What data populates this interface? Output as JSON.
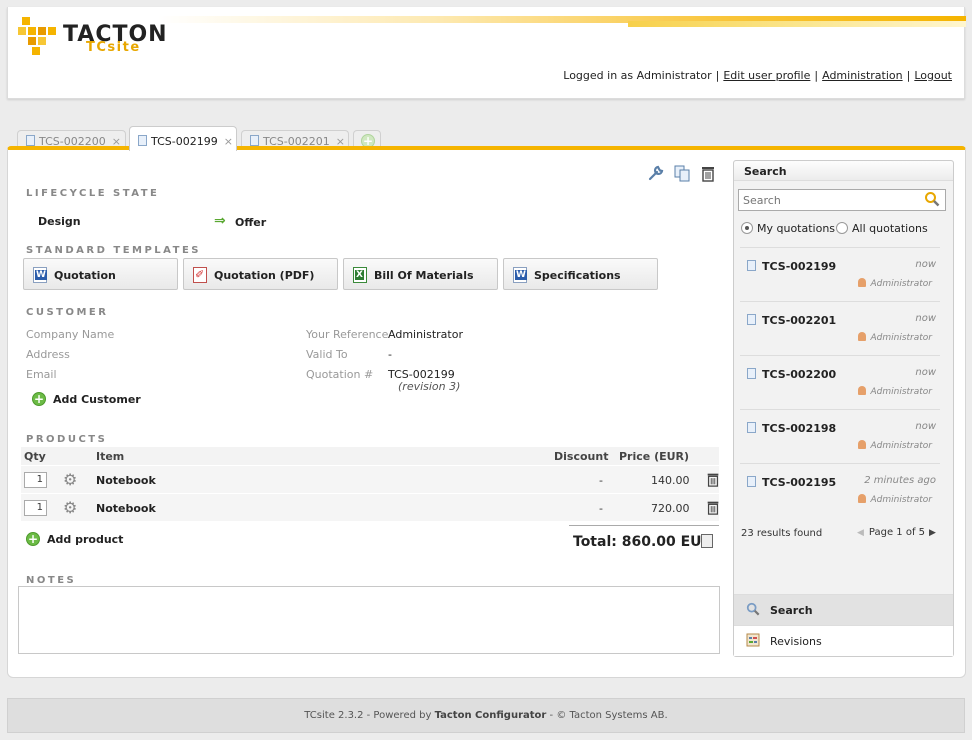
{
  "brand": {
    "name": "TACTON",
    "product": "TCsite"
  },
  "header": {
    "logged_in_text": "Logged in as Administrator",
    "edit_profile": "Edit user profile",
    "administration": "Administration",
    "logout": "Logout"
  },
  "tabs": [
    {
      "label": "TCS-002200",
      "active": false
    },
    {
      "label": "TCS-002199",
      "active": true
    },
    {
      "label": "TCS-002201",
      "active": false
    }
  ],
  "tab_close_glyph": "×",
  "tab_add_glyph": "+",
  "lifecycle": {
    "title": "LIFECYCLE STATE",
    "current": "Design",
    "next": "Offer",
    "arrow_glyph": "⇒"
  },
  "templates": {
    "title": "STANDARD TEMPLATES",
    "items": [
      "Quotation",
      "Quotation (PDF)",
      "Bill Of Materials",
      "Specifications"
    ]
  },
  "customer": {
    "title": "CUSTOMER",
    "company_label": "Company Name",
    "address_label": "Address",
    "email_label": "Email",
    "reference_label": "Your Reference",
    "reference_value": "Administrator",
    "valid_label": "Valid To",
    "valid_value": "-",
    "quotation_label": "Quotation #",
    "quotation_value": "TCS-002199",
    "revision": "(revision 3)",
    "add_customer": "Add Customer"
  },
  "products": {
    "title": "PRODUCTS",
    "headers": {
      "qty": "Qty",
      "item": "Item",
      "discount": "Discount",
      "price": "Price (EUR)"
    },
    "rows": [
      {
        "qty": "1",
        "item": "Notebook",
        "discount": "-",
        "price": "140.00"
      },
      {
        "qty": "1",
        "item": "Notebook",
        "discount": "-",
        "price": "720.00"
      }
    ],
    "add_product": "Add product",
    "total": "Total: 860.00 EUR"
  },
  "notes": {
    "title": "NOTES"
  },
  "search": {
    "title": "Search",
    "placeholder": "Search",
    "radio_mine": "My quotations",
    "radio_all": "All quotations",
    "results": [
      {
        "id": "TCS-002199",
        "time": "now",
        "user": "Administrator"
      },
      {
        "id": "TCS-002201",
        "time": "now",
        "user": "Administrator"
      },
      {
        "id": "TCS-002200",
        "time": "now",
        "user": "Administrator"
      },
      {
        "id": "TCS-002198",
        "time": "now",
        "user": "Administrator"
      },
      {
        "id": "TCS-002195",
        "time": "2 minutes ago",
        "user": "Administrator"
      }
    ],
    "results_found": "23 results found",
    "page_text": "Page 1 of 5"
  },
  "side_nav": {
    "search": "Search",
    "revisions": "Revisions"
  },
  "footer": {
    "prefix": "TCsite 2.3.2 - Powered by",
    "powered": "Tacton Configurator",
    "suffix": "- © Tacton Systems AB."
  },
  "colors": {
    "accent": "#f5b400",
    "add_green": "#6cbb46"
  }
}
